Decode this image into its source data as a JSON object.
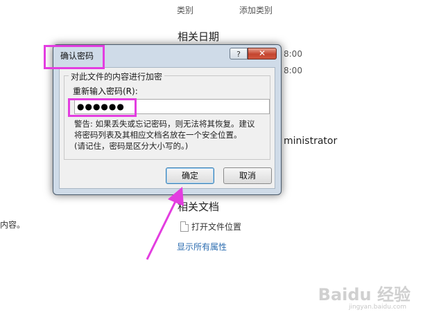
{
  "background": {
    "category_label": "类别",
    "add_category": "添加类别",
    "related_dates": "相关日期",
    "time1": "8:00",
    "time2": "8:00",
    "administrator_fragment": "ministrator",
    "left_fragment": "内容。",
    "related_docs": "相关文档",
    "open_file_location": "打开文件位置",
    "show_all_properties": "显示所有属性"
  },
  "dialog": {
    "title": "确认密码",
    "help_glyph": "?",
    "close_glyph": "✕",
    "group_title": "对此文件的内容进行加密",
    "reenter_label": "重新输入密码(R):",
    "password_value": "●●●●●●",
    "warning_line1": "警告: 如果丢失或忘记密码，则无法将其恢复。建议",
    "warning_line2": "将密码列表及其相应文档名放在一个安全位置。",
    "warning_line3": "(请记住，密码是区分大小写的。)",
    "ok_label": "确定",
    "cancel_label": "取消"
  },
  "watermark": {
    "brand": "Baidu 经验",
    "url": "jingyan.baidu.com"
  },
  "colors": {
    "highlight": "#e33de0",
    "link": "#2b6cb0",
    "dialog_frame": "#cfdbe8"
  }
}
